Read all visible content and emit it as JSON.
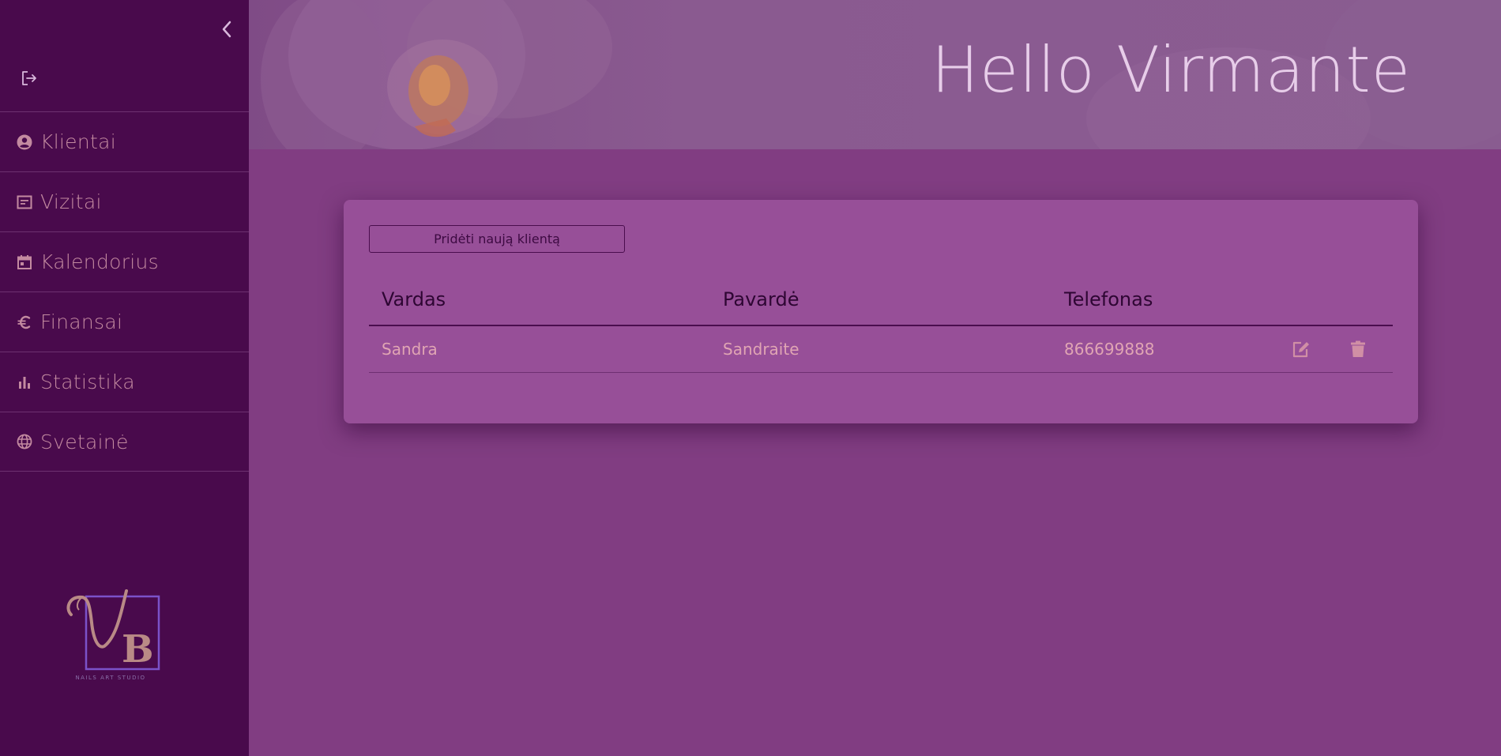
{
  "app": {
    "greeting": "Hello Virmante"
  },
  "sidebar": {
    "items": [
      {
        "label": "Klientai",
        "icon": "account-circle-icon"
      },
      {
        "label": "Vizitai",
        "icon": "list-alt-icon"
      },
      {
        "label": "Kalendorius",
        "icon": "calendar-icon"
      },
      {
        "label": "Finansai",
        "icon": "euro-icon"
      },
      {
        "label": "Statistika",
        "icon": "bar-chart-icon"
      },
      {
        "label": "Svetainė",
        "icon": "globe-icon"
      }
    ],
    "logo_text": "NAILS ART STUDIO"
  },
  "clients": {
    "add_button": "Pridėti naują klientą",
    "columns": [
      "Vardas",
      "Pavardė",
      "Telefonas"
    ],
    "rows": [
      {
        "vardas": "Sandra",
        "pavarde": "Sandraite",
        "telefonas": "866699888"
      }
    ]
  },
  "colors": {
    "sidebar": "#490a4c",
    "main": "#813d82",
    "card": "#974f98",
    "accent_text": "#c38aa0"
  }
}
